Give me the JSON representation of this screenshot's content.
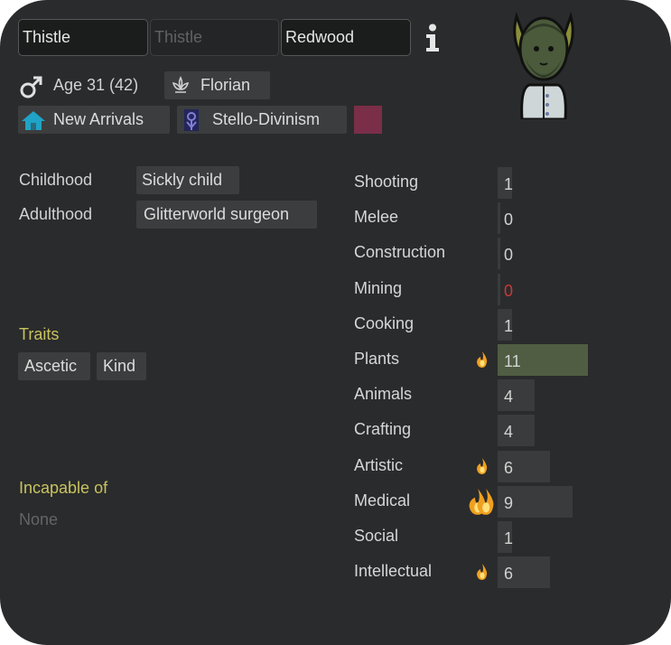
{
  "names": {
    "first": "Thistle",
    "nick": "Thistle",
    "last": "Redwood"
  },
  "bio": {
    "age_label": "Age 31 (42)",
    "xenotype": "Florian",
    "faction": "New Arrivals",
    "ideoligion": "Stello-Divinism",
    "favorite_color": "#7a2e48"
  },
  "backstory": {
    "childhood_label": "Childhood",
    "childhood_value": "Sickly child",
    "adulthood_label": "Adulthood",
    "adulthood_value": "Glitterworld surgeon"
  },
  "traits": {
    "title": "Traits",
    "items": [
      "Ascetic",
      "Kind"
    ]
  },
  "incapable": {
    "title": "Incapable of",
    "value": "None"
  },
  "skills": [
    {
      "name": "Shooting",
      "level": 1,
      "passion": 0,
      "disabled": false
    },
    {
      "name": "Melee",
      "level": 0,
      "passion": 0,
      "disabled": false
    },
    {
      "name": "Construction",
      "level": 0,
      "passion": 0,
      "disabled": false
    },
    {
      "name": "Mining",
      "level": 0,
      "passion": 0,
      "disabled": true
    },
    {
      "name": "Cooking",
      "level": 1,
      "passion": 0,
      "disabled": false
    },
    {
      "name": "Plants",
      "level": 11,
      "passion": 1,
      "disabled": false,
      "highlight": true
    },
    {
      "name": "Animals",
      "level": 4,
      "passion": 0,
      "disabled": false
    },
    {
      "name": "Crafting",
      "level": 4,
      "passion": 0,
      "disabled": false
    },
    {
      "name": "Artistic",
      "level": 6,
      "passion": 1,
      "disabled": false
    },
    {
      "name": "Medical",
      "level": 9,
      "passion": 2,
      "disabled": false
    },
    {
      "name": "Social",
      "level": 1,
      "passion": 0,
      "disabled": false
    },
    {
      "name": "Intellectual",
      "level": 6,
      "passion": 1,
      "disabled": false
    }
  ],
  "colors": {
    "bar": "#3a3b3c",
    "bar_highlight": "#505d42",
    "incapable_red": "#c83a3a",
    "section_title": "#c8c35e"
  }
}
